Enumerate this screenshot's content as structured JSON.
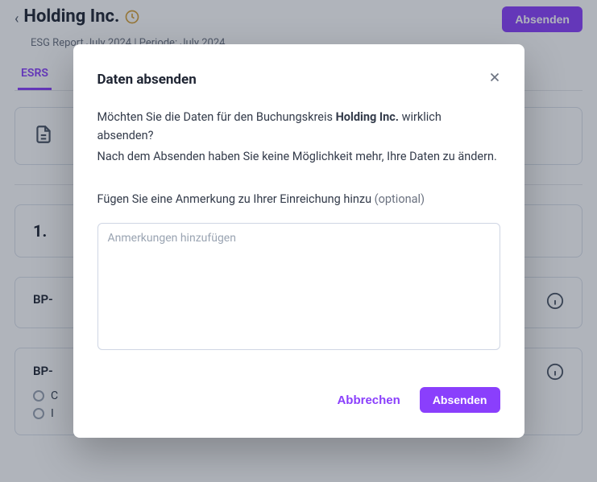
{
  "header": {
    "back_label": "‹",
    "title": "Holding Inc.",
    "submit_label": "Absenden",
    "sub_report": "ESG Report July 2024",
    "sub_sep": " | ",
    "sub_period": "Periode: July 2024"
  },
  "tabs": {
    "esrs": "ESRS"
  },
  "background": {
    "section_number": "1.",
    "row1_code": "BP-",
    "row2_code": "BP-",
    "option_a": "C",
    "option_b": "I"
  },
  "modal": {
    "title": "Daten absenden",
    "p1_pre": "Möchten Sie die Daten für den Buchungskreis ",
    "company": "Holding Inc.",
    "p1_post": " wirklich absenden?",
    "p2": "Nach dem Absenden haben Sie keine Möglichkeit mehr, Ihre Daten zu ändern.",
    "note_label": "Fügen Sie eine Anmerkung zu Ihrer Einreichung hinzu ",
    "note_optional": "(optional)",
    "textarea_placeholder": "Anmerkungen hinzufügen",
    "cancel": "Abbrechen",
    "submit": "Absenden"
  }
}
